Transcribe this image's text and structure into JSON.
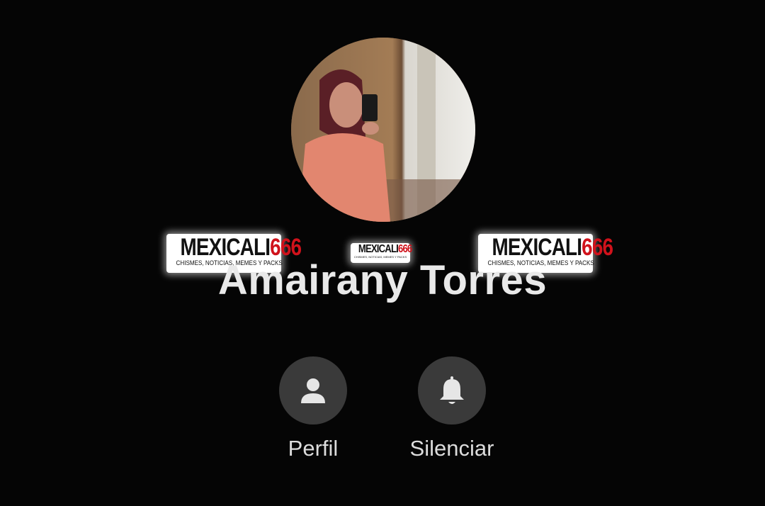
{
  "contact": {
    "name": "Amairany Torres"
  },
  "actions": [
    {
      "label": "Perfil",
      "icon": "person-icon"
    },
    {
      "label": "Silenciar",
      "icon": "bell-icon"
    }
  ],
  "watermark": {
    "brand": "MEXICALI",
    "number": "666",
    "tagline": "CHISMES, NOTICIAS, MEMES Y PACKS",
    "number_color": "#d0121b"
  },
  "colors": {
    "background": "#050505",
    "button_bg": "#3a3a3a",
    "text": "#e9e9e9"
  }
}
